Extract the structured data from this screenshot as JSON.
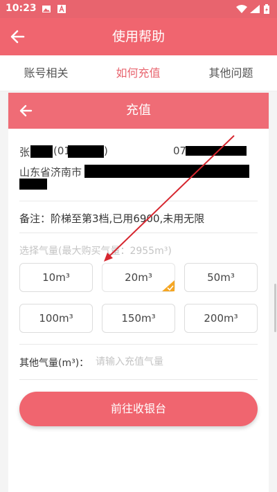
{
  "status_bar": {
    "time": "10:23"
  },
  "app_bar": {
    "title": "使用帮助"
  },
  "tabs": [
    {
      "label": "账号相关",
      "active": false
    },
    {
      "label": "如何充值",
      "active": true
    },
    {
      "label": "其他问题",
      "active": false
    }
  ],
  "recharge": {
    "title": "充值",
    "user": {
      "name_prefix": "张",
      "id_prefix": "(01",
      "id_suffix": ")",
      "phone_prefix": "07",
      "address_prefix": "山东省济南市"
    },
    "note": "备注：阶梯至第3档,已用6900,未用无限",
    "select_hint": "选择气量(最大购买气量：2955m³)",
    "amounts": [
      {
        "label": "10m³",
        "selected": false
      },
      {
        "label": "20m³",
        "selected": true
      },
      {
        "label": "50m³",
        "selected": false
      },
      {
        "label": "100m³",
        "selected": false
      },
      {
        "label": "150m³",
        "selected": false
      },
      {
        "label": "200m³",
        "selected": false
      }
    ],
    "other_label": "其他气量(m³)：",
    "other_placeholder": "请输入充值气量",
    "pay_button": "前往收银台"
  },
  "colors": {
    "primary": "#f0656f",
    "status_bar": "#e8646e",
    "selected_check": "#f5a623",
    "annotation_arrow": "#d6262f"
  }
}
